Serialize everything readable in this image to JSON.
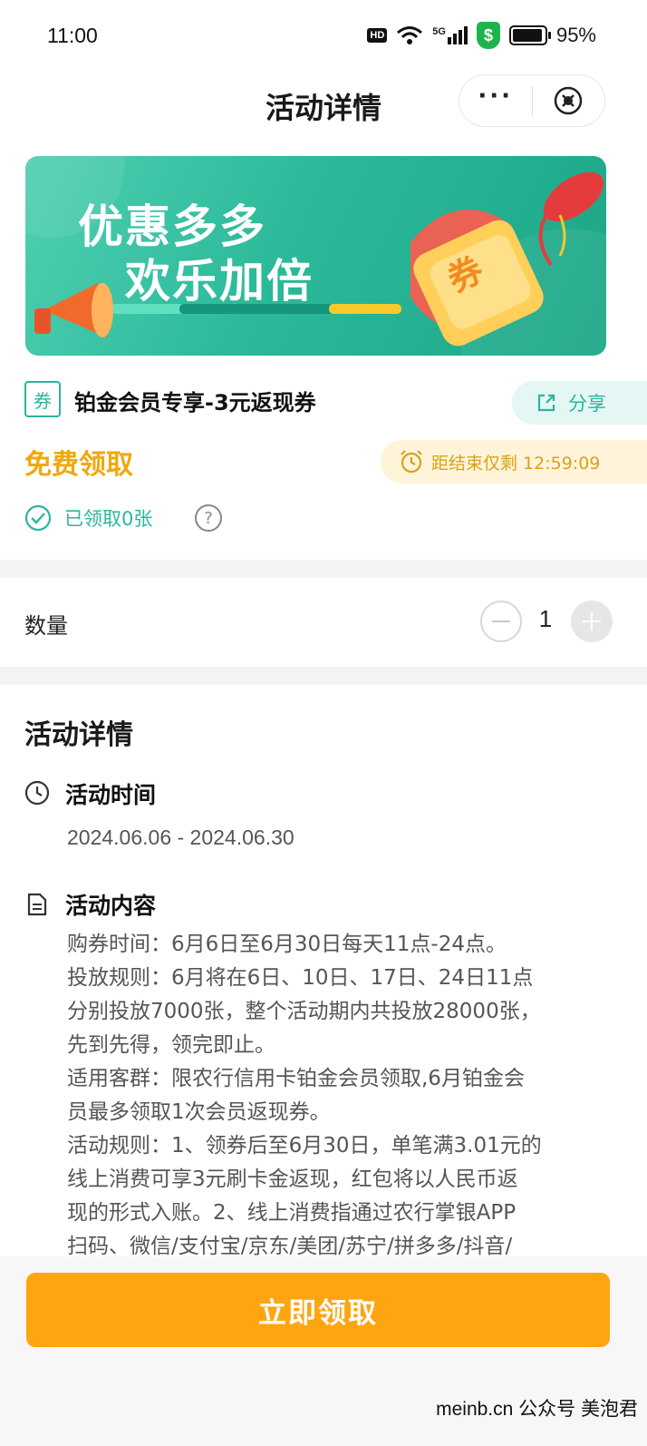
{
  "status_bar": {
    "time": "11:00",
    "hd": "HD",
    "network": "5G",
    "battery": "95%",
    "battery_level": 0.95
  },
  "nav": {
    "title": "活动详情",
    "more": "···"
  },
  "banner": {
    "line1": "优惠多多",
    "line2": "欢乐加倍",
    "coupon_glyph": "券"
  },
  "coupon": {
    "tag": "券",
    "title": "铂金会员专享-3元返现券",
    "share_label": "分享",
    "free_label": "免费领取",
    "timer_text": "距结束仅剩 12:59:09",
    "claimed_text": "已领取0张"
  },
  "quantity": {
    "label": "数量",
    "value": "1"
  },
  "details": {
    "heading": "活动详情",
    "time_title": "活动时间",
    "time_value": "2024.06.06 - 2024.06.30",
    "content_title": "活动内容",
    "content_lines": [
      "购券时间：6月6日至6月30日每天11点-24点。",
      "投放规则：6月将在6日、10日、17日、24日11点",
      "分别投放7000张，整个活动期内共投放28000张，",
      "先到先得，领完即止。",
      "适用客群：限农行信用卡铂金会员领取,6月铂金会",
      "员最多领取1次会员返现券。",
      "活动规则：1、领券后至6月30日，单笔满3.01元的",
      "线上消费可享3元刷卡金返现，红包将以人民币返",
      "现的形式入账。2、线上消费指通过农行掌银APP",
      "扫码、微信/支付宝/京东/美团/苏宁/拼多多/抖音/"
    ]
  },
  "footer": {
    "claim_button": "立即领取",
    "watermark": "meinb.cn  公众号 美泡君"
  },
  "colors": {
    "accent_green": "#2bb5a0",
    "accent_orange": "#ffa511",
    "timer_bg": "#fff4d9"
  }
}
